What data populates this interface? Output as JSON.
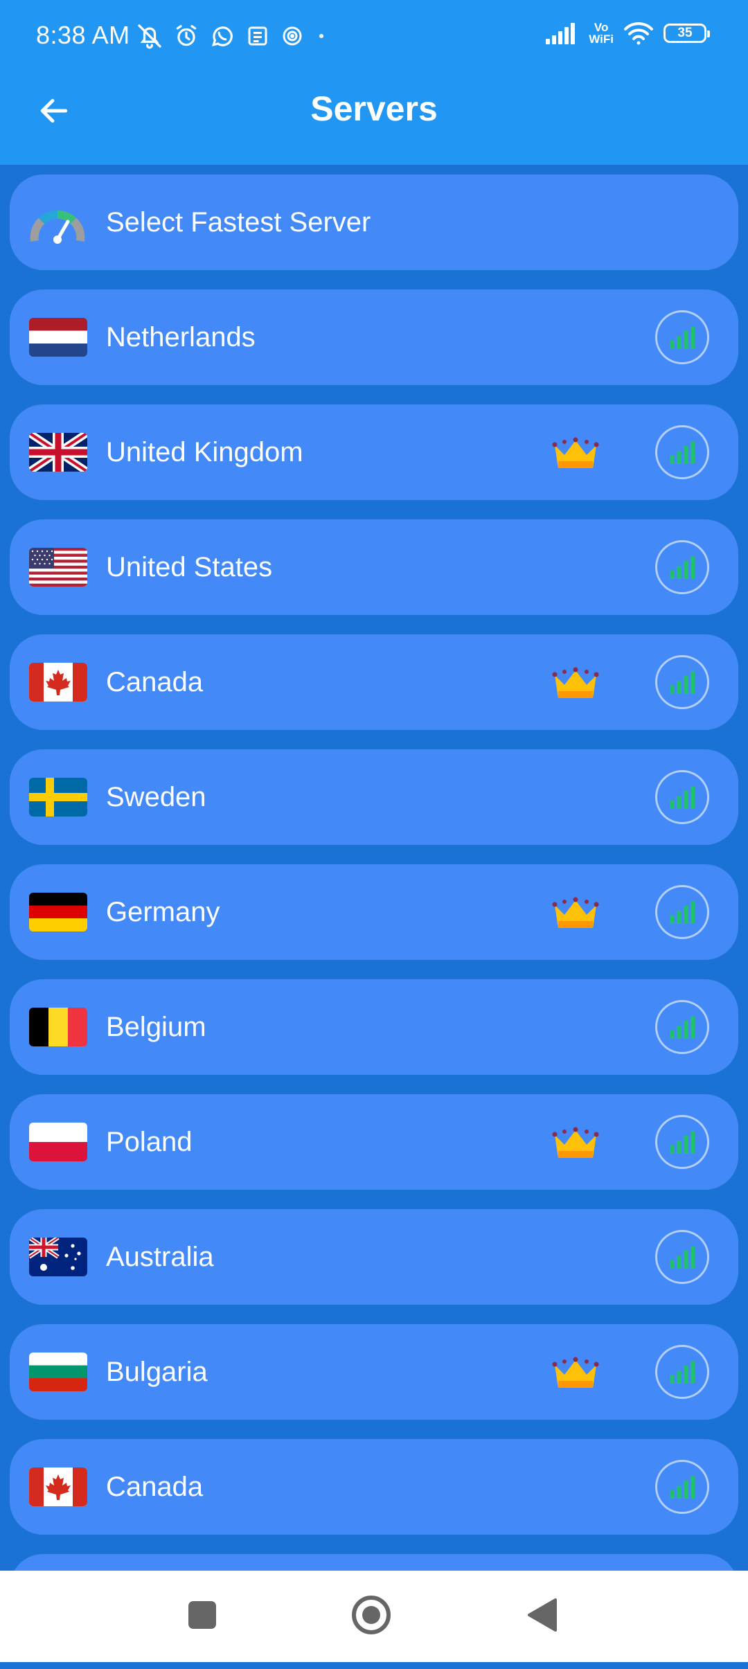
{
  "status_bar": {
    "time": "8:38 AM",
    "network_label_top": "Vo",
    "network_label_bottom": "WiFi",
    "battery": "35"
  },
  "header": {
    "title": "Servers"
  },
  "fastest": {
    "label": "Select Fastest Server"
  },
  "servers": [
    {
      "name": "Netherlands",
      "flag": "netherlands-flag",
      "premium": false
    },
    {
      "name": "United Kingdom",
      "flag": "united-kingdom-flag",
      "premium": true
    },
    {
      "name": "United States",
      "flag": "united-states-flag",
      "premium": false
    },
    {
      "name": "Canada",
      "flag": "canada-flag",
      "premium": true
    },
    {
      "name": "Sweden",
      "flag": "sweden-flag",
      "premium": false
    },
    {
      "name": "Germany",
      "flag": "germany-flag",
      "premium": true
    },
    {
      "name": "Belgium",
      "flag": "belgium-flag",
      "premium": false
    },
    {
      "name": "Poland",
      "flag": "poland-flag",
      "premium": true
    },
    {
      "name": "Australia",
      "flag": "australia-flag",
      "premium": false
    },
    {
      "name": "Bulgaria",
      "flag": "bulgaria-flag",
      "premium": true
    },
    {
      "name": "Canada",
      "flag": "canada-flag",
      "premium": false
    }
  ],
  "colors": {
    "header": "#2196f3",
    "list_background": "#1a72d4",
    "row": "#438af8",
    "signal_bars": "#21c06e",
    "crown": "#ffc107"
  }
}
